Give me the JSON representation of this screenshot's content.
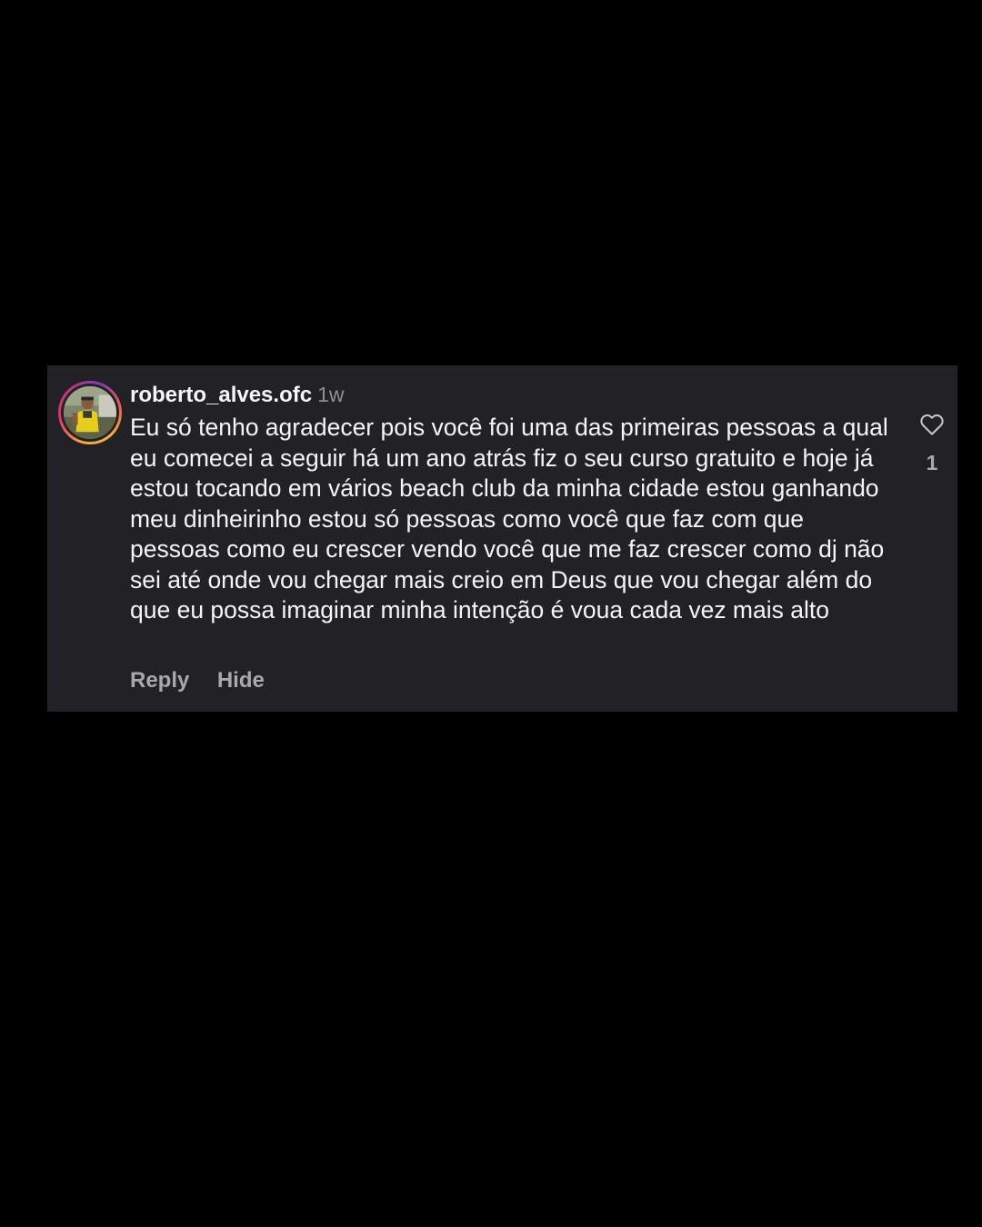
{
  "comment": {
    "username": "roberto_alves.ofc",
    "time": "1w",
    "text": "Eu só tenho agradecer pois você foi uma das primeiras pessoas a qual eu comecei a seguir há um ano atrás fiz o seu curso gratuito e hoje já estou tocando em vários beach club da minha cidade estou ganhando meu dinheirinho estou só pessoas como você que faz com que pessoas como eu crescer vendo você que me faz crescer como dj não sei até onde vou chegar mais creio em Deus que vou chegar além do que eu possa imaginar minha intenção é voua cada vez mais alto",
    "actions": {
      "reply_label": "Reply",
      "hide_label": "Hide"
    },
    "likes": "1",
    "icons": {
      "like": "heart-icon"
    }
  },
  "colors": {
    "background": "#000000",
    "card": "#222226",
    "text_primary": "#f5f5f5",
    "text_secondary": "#8e8e93"
  }
}
